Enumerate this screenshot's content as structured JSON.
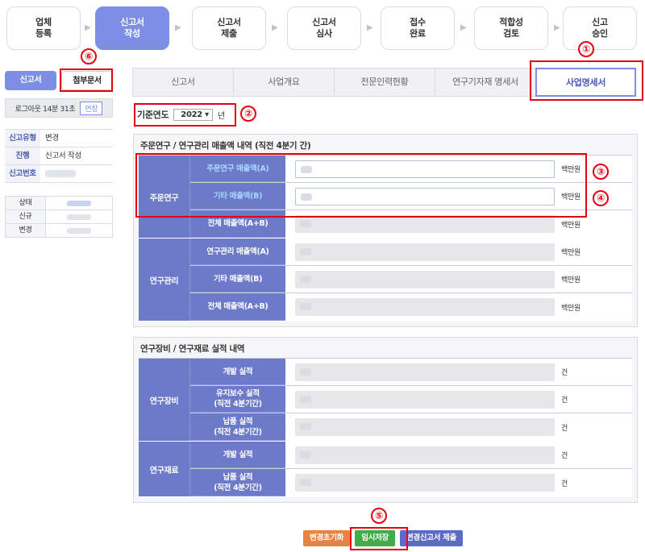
{
  "steps": [
    {
      "label": "업체\n등록",
      "active": false
    },
    {
      "label": "신고서\n작성",
      "active": true
    },
    {
      "label": "신고서\n제출",
      "active": false
    },
    {
      "label": "신고서\n심사",
      "active": false
    },
    {
      "label": "접수\n완료",
      "active": false
    },
    {
      "label": "적합성\n검토",
      "active": false
    },
    {
      "label": "신고\n승인",
      "active": false
    }
  ],
  "callouts": {
    "c1": "①",
    "c2": "②",
    "c3": "③",
    "c4": "④",
    "c5": "⑤",
    "c6": "⑥"
  },
  "left_tabs": {
    "report": "신고서",
    "attachments": "첨부문서"
  },
  "session": {
    "logout_text": "로그아웃 14분 31초",
    "extend_label": "연장"
  },
  "info": [
    {
      "key": "신고유형",
      "value": "변경"
    },
    {
      "key": "진행",
      "value": "신고서 작성"
    },
    {
      "key": "신고번호",
      "value": ""
    }
  ],
  "status_rows": [
    "상태",
    "신규",
    "변경"
  ],
  "main_tabs": [
    "신고서",
    "사업개요",
    "전문인력현황",
    "연구기자재 명세서",
    "사업명세서"
  ],
  "main_tab_selected": 4,
  "year": {
    "label": "기준연도",
    "value": "2022",
    "unit": "년"
  },
  "revenue": {
    "title": "주문연구 / 연구관리 매출액 내역 (직전 4분기 간)",
    "groups": [
      {
        "name": "주문연구",
        "rows": [
          {
            "label": "주문연구 매출액(A)",
            "unit": "백만원",
            "editable": true
          },
          {
            "label": "기타 매출액(B)",
            "unit": "백만원",
            "editable": true
          },
          {
            "label": "전체 매출액(A+B)",
            "unit": "백만원",
            "editable": false
          }
        ]
      },
      {
        "name": "연구관리",
        "rows": [
          {
            "label": "연구관리 매출액(A)",
            "unit": "백만원",
            "editable": false
          },
          {
            "label": "기타 매출액(B)",
            "unit": "백만원",
            "editable": false
          },
          {
            "label": "전체 매출액(A+B)",
            "unit": "백만원",
            "editable": false
          }
        ]
      }
    ]
  },
  "equipment": {
    "title": "연구장비 / 연구재료 실적 내역",
    "groups": [
      {
        "name": "연구장비",
        "rows": [
          {
            "label": "개발 실적",
            "unit": "건"
          },
          {
            "label": "유지보수 실적\n(직전 4분기간)",
            "unit": "건"
          },
          {
            "label": "납품 실적\n(직전 4분기간)",
            "unit": "건"
          }
        ]
      },
      {
        "name": "연구재료",
        "rows": [
          {
            "label": "개발 실적",
            "unit": "건"
          },
          {
            "label": "납품 실적\n(직전 4분기간)",
            "unit": "건"
          }
        ]
      }
    ]
  },
  "buttons": [
    {
      "label": "변경초기화",
      "color": "#e8843f"
    },
    {
      "label": "임시저장",
      "color": "#3fae49"
    },
    {
      "label": "변경신고서 제출",
      "color": "#5b6bc6"
    }
  ],
  "colors": {
    "accent": "#7d8ee4",
    "header_cell": "#6c7ac9",
    "callout": "#e60012"
  }
}
